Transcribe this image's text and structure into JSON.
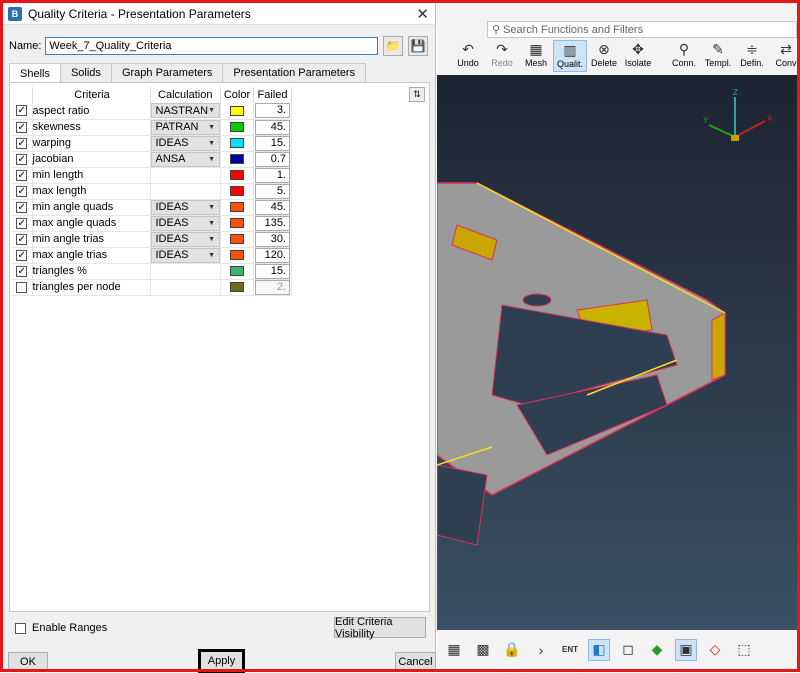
{
  "dialog": {
    "title": "Quality Criteria - Presentation Parameters",
    "name_label": "Name:",
    "name_value": "Week_7_Quality_Criteria",
    "tabs": [
      "Shells",
      "Solids",
      "Graph Parameters",
      "Presentation Parameters"
    ],
    "columns": [
      "Criteria",
      "Calculation",
      "Color",
      "Failed"
    ],
    "rows": [
      {
        "checked": true,
        "name": "aspect ratio",
        "calc": "NASTRAN",
        "color": "#ffff00",
        "failed": "3."
      },
      {
        "checked": true,
        "name": "skewness",
        "calc": "PATRAN",
        "color": "#00cc00",
        "failed": "45."
      },
      {
        "checked": true,
        "name": "warping",
        "calc": "IDEAS",
        "color": "#00e5ff",
        "failed": "15."
      },
      {
        "checked": true,
        "name": "jacobian",
        "calc": "ANSA",
        "color": "#0000a0",
        "failed": "0.7"
      },
      {
        "checked": true,
        "name": "min length",
        "calc": "",
        "color": "#ff0000",
        "failed": "1."
      },
      {
        "checked": true,
        "name": "max length",
        "calc": "",
        "color": "#ff0000",
        "failed": "5."
      },
      {
        "checked": true,
        "name": "min angle quads",
        "calc": "IDEAS",
        "color": "#ff5000",
        "failed": "45."
      },
      {
        "checked": true,
        "name": "max angle quads",
        "calc": "IDEAS",
        "color": "#ff5000",
        "failed": "135."
      },
      {
        "checked": true,
        "name": "min angle trias",
        "calc": "IDEAS",
        "color": "#ff5000",
        "failed": "30."
      },
      {
        "checked": true,
        "name": "max angle trias",
        "calc": "IDEAS",
        "color": "#ff5000",
        "failed": "120."
      },
      {
        "checked": true,
        "name": "triangles %",
        "calc": "",
        "color": "#3cb371",
        "failed": "15."
      },
      {
        "checked": false,
        "name": "triangles per node",
        "calc": "",
        "color": "#6b6b1a",
        "failed": "2."
      }
    ],
    "enable_ranges_label": "Enable Ranges",
    "edit_visibility_label": "Edit Criteria Visibility",
    "ok_label": "OK",
    "apply_label": "Apply",
    "cancel_label": "Cancel"
  },
  "app": {
    "search_placeholder": "Search Functions and Filters",
    "tools": [
      {
        "label": "Undo",
        "icon": "undo-icon"
      },
      {
        "label": "Redo",
        "icon": "redo-icon"
      },
      {
        "label": "Mesh",
        "icon": "mesh-icon"
      },
      {
        "label": "Qualit.",
        "icon": "quality-icon"
      },
      {
        "label": "Delete",
        "icon": "delete-icon"
      },
      {
        "label": "Isolate",
        "icon": "isolate-icon"
      },
      {
        "label": "Conn.",
        "icon": "connection-icon"
      },
      {
        "label": "Templ.",
        "icon": "template-icon"
      },
      {
        "label": "Defin.",
        "icon": "define-icon"
      },
      {
        "label": "Conv",
        "icon": "convert-icon"
      }
    ],
    "axis_labels": {
      "x": "X",
      "y": "Y",
      "z": "Z"
    },
    "bottom_badge": "ENT"
  }
}
